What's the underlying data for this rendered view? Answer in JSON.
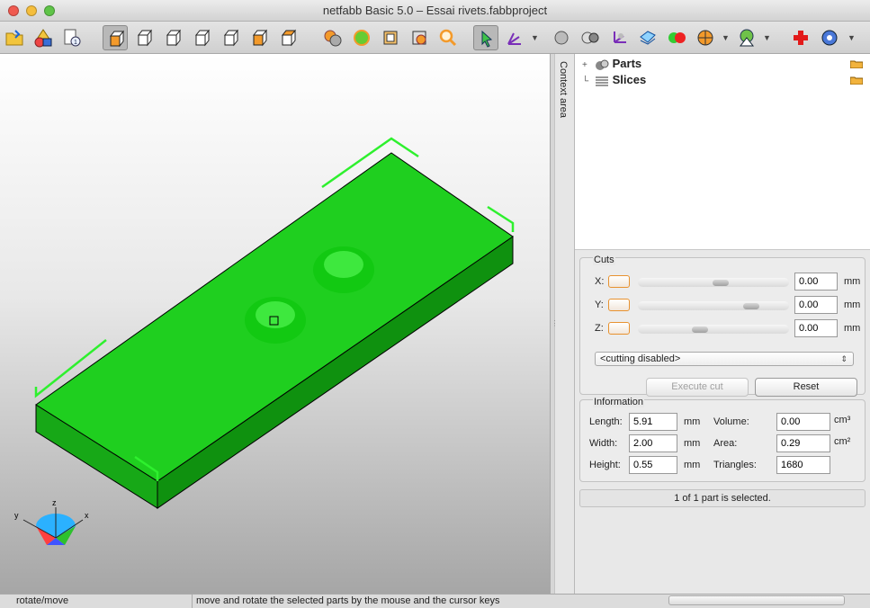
{
  "window": {
    "title": "netfabb Basic 5.0 – Essai rivets.fabbproject"
  },
  "toolbar": {
    "buttons": [
      "open-project",
      "add-part",
      "export",
      "view-3d",
      "view-front",
      "view-back",
      "view-left",
      "view-right",
      "view-top",
      "view-bottom",
      "repair",
      "merge",
      "wireframe",
      "shaded",
      "zoom",
      "select-pointer",
      "move",
      "sphere",
      "split",
      "axes",
      "slice",
      "colors",
      "analysis",
      "measure",
      "add",
      "help"
    ]
  },
  "viewport": {
    "triad": {
      "x": "x",
      "y": "y",
      "z": "z"
    },
    "model_color": "#1fcf1f"
  },
  "context": {
    "tab_label": "Context area"
  },
  "tree": {
    "items": [
      {
        "label": "Parts"
      },
      {
        "label": "Slices"
      }
    ]
  },
  "cuts": {
    "title": "Cuts",
    "rows": [
      {
        "axis": "X:",
        "value": "0.00",
        "unit": "mm",
        "pos": 0.55
      },
      {
        "axis": "Y:",
        "value": "0.00",
        "unit": "mm",
        "pos": 0.78
      },
      {
        "axis": "Z:",
        "value": "0.00",
        "unit": "mm",
        "pos": 0.4
      }
    ],
    "mode": "<cutting disabled>",
    "execute_label": "Execute cut",
    "reset_label": "Reset"
  },
  "info": {
    "title": "Information",
    "length": {
      "label": "Length:",
      "value": "5.91",
      "unit": "mm"
    },
    "width": {
      "label": "Width:",
      "value": "2.00",
      "unit": "mm"
    },
    "height": {
      "label": "Height:",
      "value": "0.55",
      "unit": "mm"
    },
    "volume": {
      "label": "Volume:",
      "value": "0.00",
      "unit": "cm³"
    },
    "area": {
      "label": "Area:",
      "value": "0.29",
      "unit": "cm²"
    },
    "triangles": {
      "label": "Triangles:",
      "value": "1680"
    }
  },
  "selection": {
    "message": "1 of 1 part is selected."
  },
  "status": {
    "mode": "rotate/move",
    "hint": "move and rotate the selected parts by the mouse and the cursor keys"
  }
}
